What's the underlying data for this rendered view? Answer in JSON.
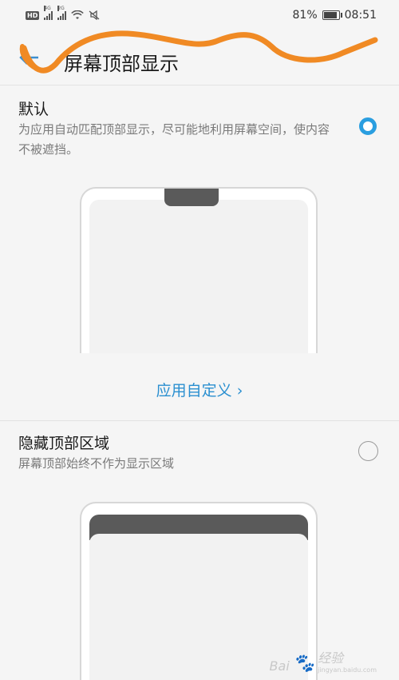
{
  "status_bar": {
    "hd": "HD",
    "sig1_tag": "4G",
    "sig2_tag": "2G",
    "battery": "81%",
    "time": "08:51"
  },
  "header": {
    "title": "屏幕顶部显示"
  },
  "options": [
    {
      "title": "默认",
      "description": "为应用自动匹配顶部显示，尽可能地利用屏幕空间，使内容不被遮挡。",
      "selected": true
    },
    {
      "title": "隐藏顶部区域",
      "description": "屏幕顶部始终不作为显示区域",
      "selected": false
    }
  ],
  "custom_link": "应用自定义 ›",
  "watermark": {
    "brand": "Bai",
    "suffix": "经验",
    "site": "jingyan.baidu.com"
  },
  "colors": {
    "accent": "#2a9ee0",
    "scribble": "#f08a24"
  }
}
